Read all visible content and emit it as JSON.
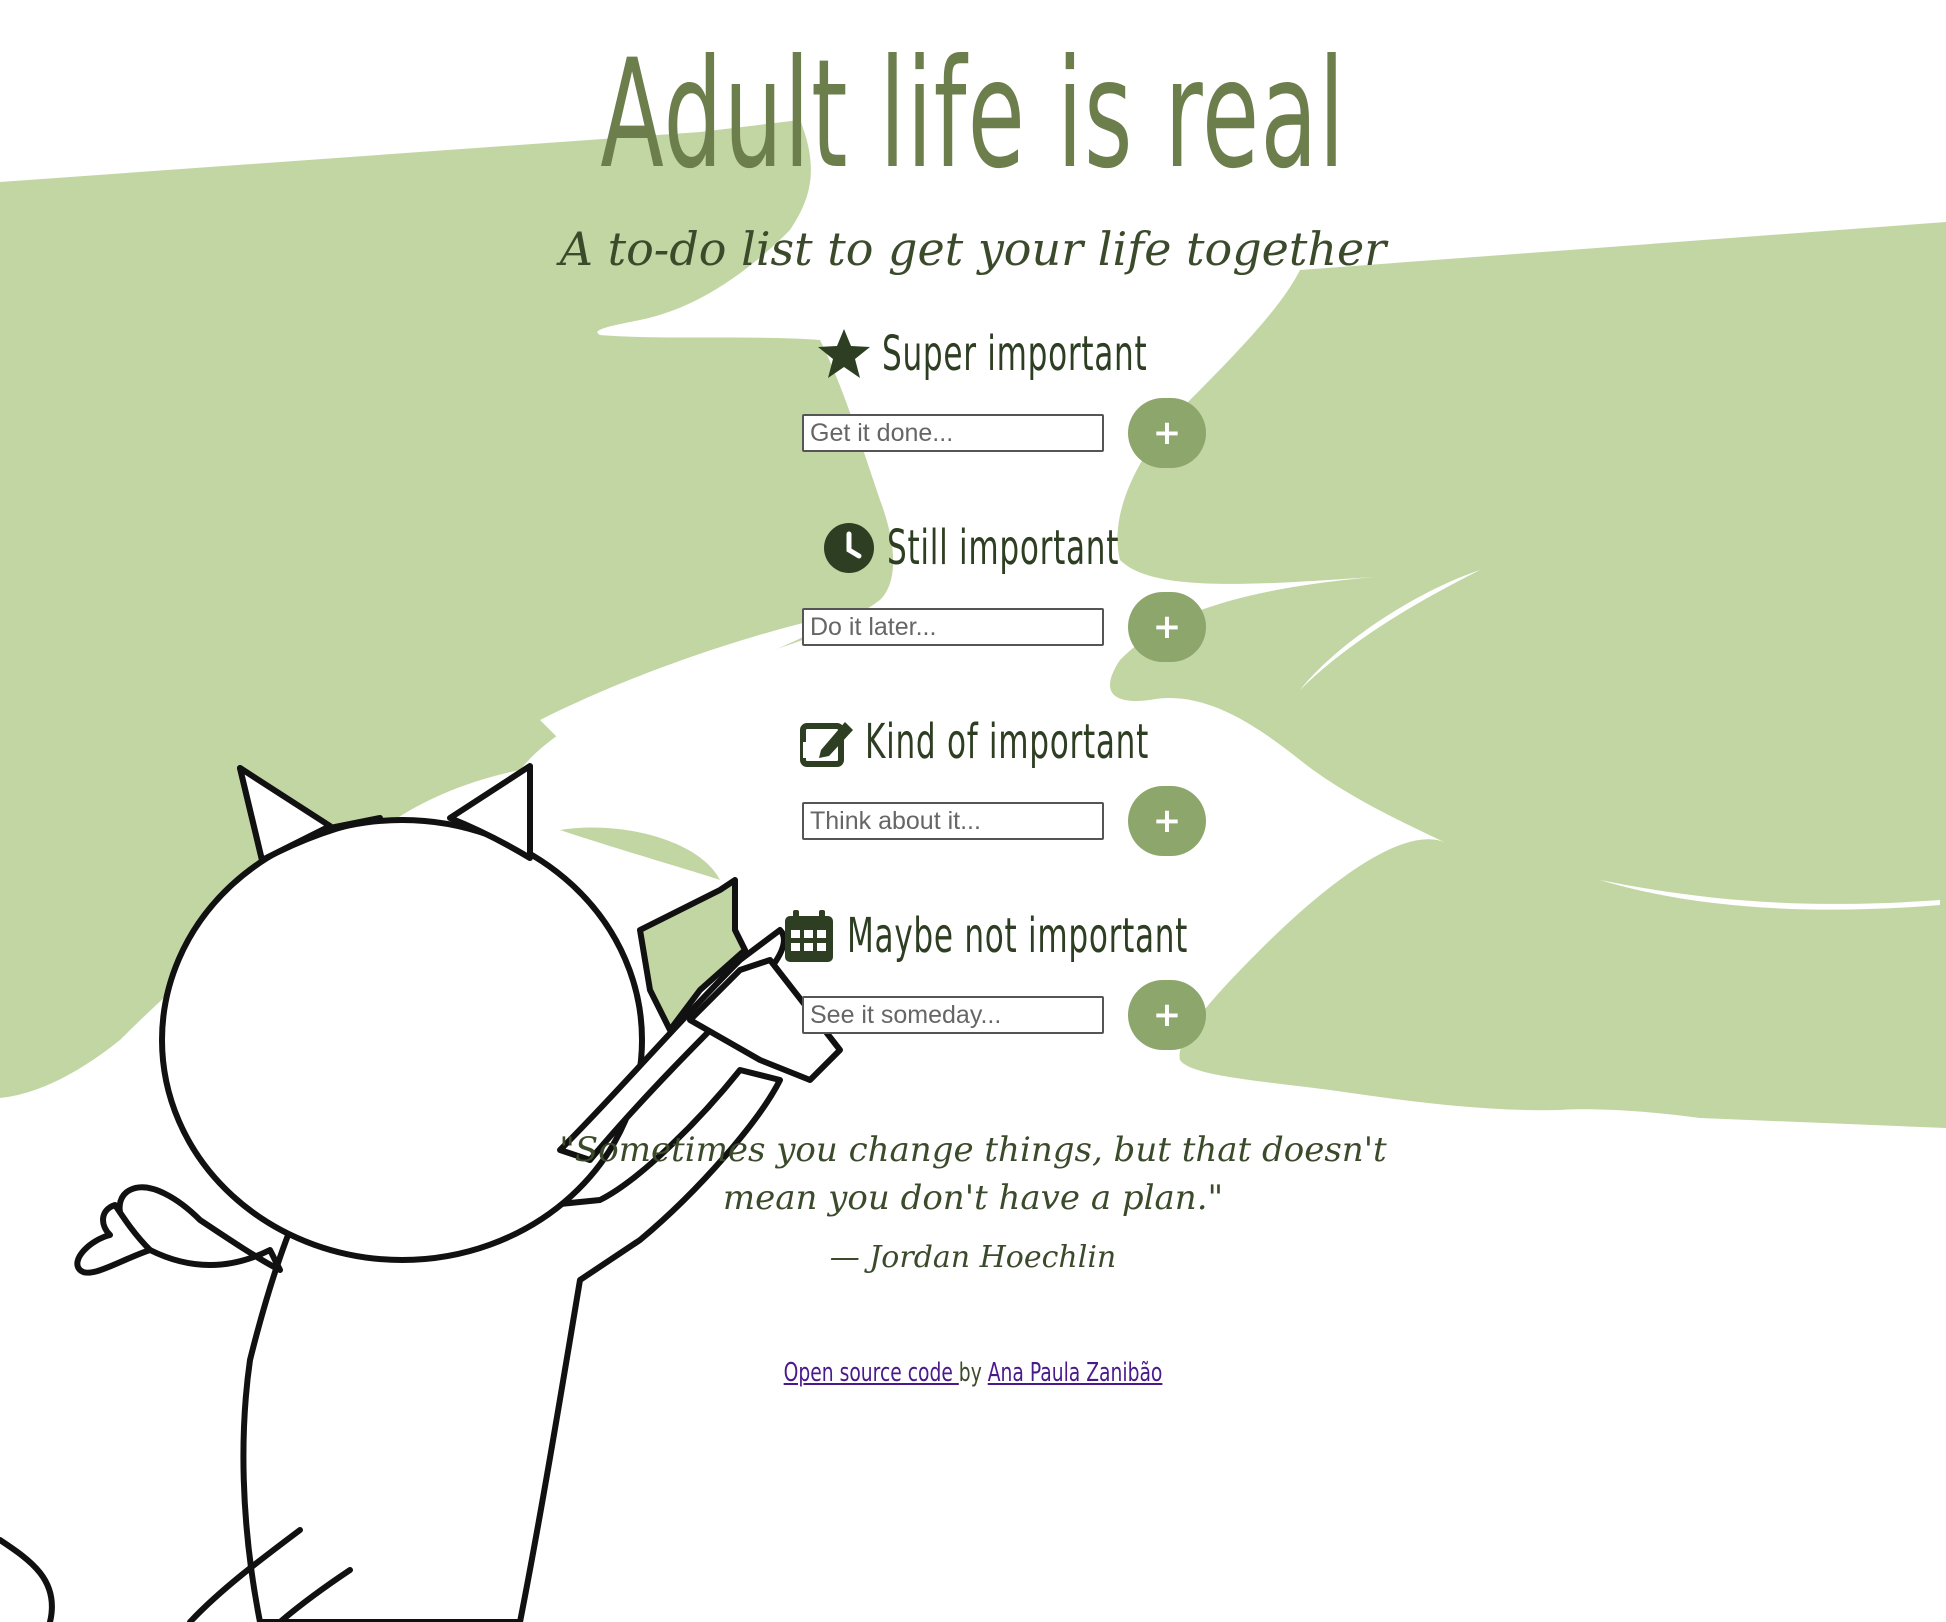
{
  "page": {
    "title": "Adult life is real",
    "subtitle": "A to-do list to get your life together"
  },
  "sections": [
    {
      "id": "super",
      "icon": "star-icon",
      "heading": "Super important",
      "placeholder": "Get it done...",
      "button_label": "+"
    },
    {
      "id": "still",
      "icon": "clock-icon",
      "heading": "Still important",
      "placeholder": "Do it later...",
      "button_label": "+"
    },
    {
      "id": "kind",
      "icon": "edit-icon",
      "heading": "Kind of important",
      "placeholder": "Think about it...",
      "button_label": "+"
    },
    {
      "id": "maybe",
      "icon": "calendar-icon",
      "heading": "Maybe not important",
      "placeholder": "See it someday...",
      "button_label": "+"
    }
  ],
  "quote": {
    "line1": "\"Sometimes you change things, but that doesn't",
    "line2": "mean you don't have a plan.\"",
    "author": "— Jordan Hoechlin"
  },
  "footer": {
    "link1": "Open source code ",
    "by": "by",
    "link2": "Ana Paula Zanibão"
  },
  "colors": {
    "accent_green": "#8da66b",
    "brush_green": "#c2d6a4",
    "title_green": "#6d7e4d",
    "text_dark": "#2e3e22",
    "link_purple": "#4a1a8c"
  }
}
